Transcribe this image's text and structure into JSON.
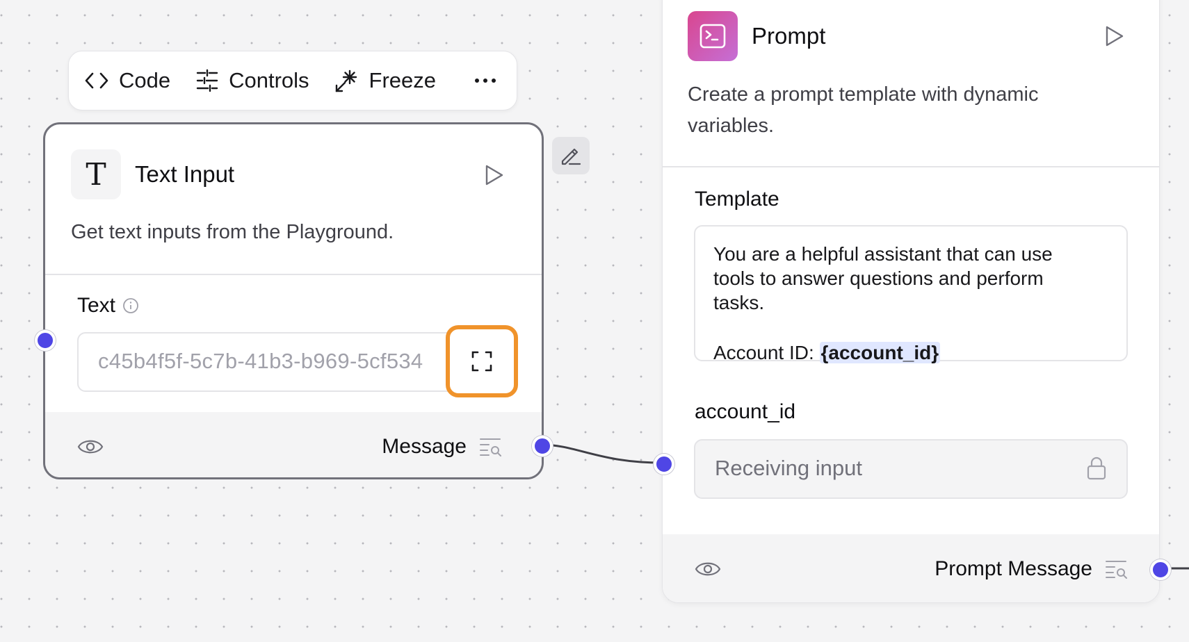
{
  "toolbar": {
    "code_label": "Code",
    "controls_label": "Controls",
    "freeze_label": "Freeze"
  },
  "text_input_node": {
    "title": "Text Input",
    "icon_glyph": "T",
    "description": "Get text inputs from the Playground.",
    "field_label": "Text",
    "input_value": "c45b4f5f-5c7b-41b3-b969-5cf534",
    "output_label": "Message"
  },
  "prompt_node": {
    "title": "Prompt",
    "description_line1": "Create a prompt template with dynamic",
    "description_line2": "variables.",
    "template_label": "Template",
    "template_line1": "You are a helpful assistant that can use",
    "template_line2": "tools to answer questions and perform",
    "template_line3": "tasks.",
    "template_account_prefix": "Account ID: ",
    "template_variable": "{account_id}",
    "variable_label": "account_id",
    "variable_placeholder": "Receiving input",
    "output_label": "Prompt Message"
  },
  "colors": {
    "handle": "#4f46e5",
    "highlight_border": "#f0932b",
    "prompt_icon_gradient_start": "#d9468f",
    "prompt_icon_gradient_end": "#c56fd6",
    "variable_highlight_bg": "#e0e7ff"
  },
  "icons": [
    "code-icon",
    "controls-icon",
    "freeze-icon",
    "more-icon",
    "text-icon",
    "play-icon",
    "edit-icon",
    "info-icon",
    "expand-icon",
    "eye-icon",
    "inspect-output-icon",
    "terminal-icon",
    "lock-icon"
  ]
}
